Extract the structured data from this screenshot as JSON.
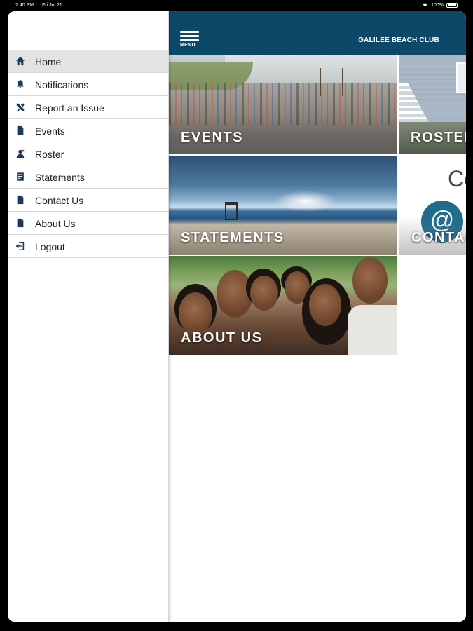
{
  "status_bar": {
    "time": "7:40 PM",
    "date": "Fri Jul 21",
    "battery": "100%"
  },
  "header": {
    "menu_label": "MENU",
    "title": "GALILEE BEACH CLUB",
    "color": "#0d4869"
  },
  "drawer": {
    "items": [
      {
        "label": "Home",
        "icon": "home-icon",
        "active": true
      },
      {
        "label": "Notifications",
        "icon": "bell-icon",
        "active": false
      },
      {
        "label": "Report an Issue",
        "icon": "tools-icon",
        "active": false
      },
      {
        "label": "Events",
        "icon": "document-icon",
        "active": false
      },
      {
        "label": "Roster",
        "icon": "person-icon",
        "active": false
      },
      {
        "label": "Statements",
        "icon": "statement-icon",
        "active": false
      },
      {
        "label": "Contact Us",
        "icon": "document-icon",
        "active": false
      },
      {
        "label": "About Us",
        "icon": "document-icon",
        "active": false
      },
      {
        "label": "Logout",
        "icon": "logout-icon",
        "active": false
      }
    ]
  },
  "tiles": {
    "events": "EVENTS",
    "roster": "ROSTER",
    "statements": "STATEMENTS",
    "contact": "CONTACT",
    "contact_partial": "Co",
    "contact_icon": "@",
    "about": "ABOUT US"
  }
}
